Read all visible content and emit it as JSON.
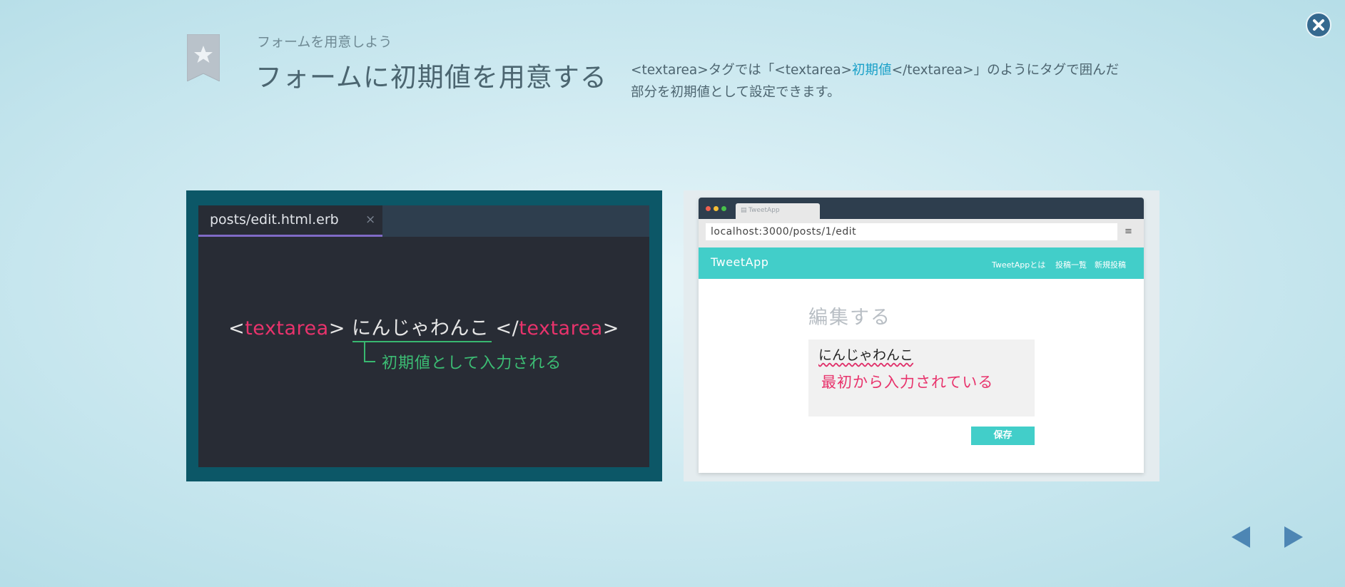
{
  "header": {
    "subtitle": "フォームを用意しよう",
    "title": "フォームに初期値を用意する",
    "description_part1": "<textarea>タグでは「<textarea>",
    "description_highlight": "初期値",
    "description_part2": "</textarea>」のようにタグで囲んだ部分を初期値として設定できます。"
  },
  "icons": {
    "bookmark": "bookmark-star-icon",
    "close": "close-icon",
    "prev": "arrow-left-icon",
    "next": "arrow-right-icon"
  },
  "editor": {
    "tab_label": "posts/edit.html.erb",
    "tab_close": "×",
    "code_open_bracket": "<",
    "code_tag": "textarea",
    "code_close_bracket": ">",
    "code_value": "にんじゃわんこ",
    "code_end_open": "</",
    "code_end_close": ">",
    "note": "初期値として入力される",
    "colors": {
      "tag": "#e8336c",
      "note": "#3cbd74",
      "background": "#282c35"
    }
  },
  "browser": {
    "tab_label": "TweetApp",
    "url": "localhost:3000/posts/1/edit",
    "menu_glyph": "≡",
    "brand": "TweetApp",
    "nav": [
      "TweetAppとは",
      "投稿一覧",
      "新規投稿"
    ],
    "page_title": "編集する",
    "textarea_value": "にんじゃわんこ",
    "textarea_note": "最初から入力されている",
    "save_label": "保存",
    "colors": {
      "accent": "#42cec9"
    }
  }
}
